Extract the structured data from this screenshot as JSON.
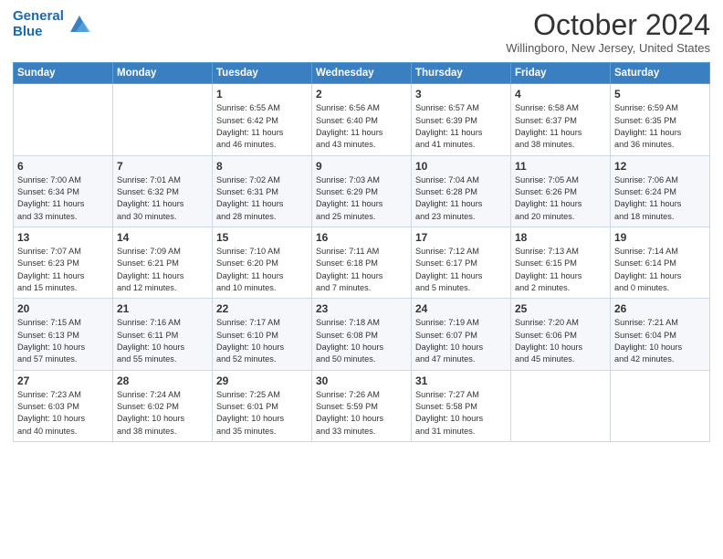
{
  "header": {
    "logo_line1": "General",
    "logo_line2": "Blue",
    "month": "October 2024",
    "location": "Willingboro, New Jersey, United States"
  },
  "columns": [
    "Sunday",
    "Monday",
    "Tuesday",
    "Wednesday",
    "Thursday",
    "Friday",
    "Saturday"
  ],
  "weeks": [
    [
      {
        "day": "",
        "info": ""
      },
      {
        "day": "",
        "info": ""
      },
      {
        "day": "1",
        "info": "Sunrise: 6:55 AM\nSunset: 6:42 PM\nDaylight: 11 hours\nand 46 minutes."
      },
      {
        "day": "2",
        "info": "Sunrise: 6:56 AM\nSunset: 6:40 PM\nDaylight: 11 hours\nand 43 minutes."
      },
      {
        "day": "3",
        "info": "Sunrise: 6:57 AM\nSunset: 6:39 PM\nDaylight: 11 hours\nand 41 minutes."
      },
      {
        "day": "4",
        "info": "Sunrise: 6:58 AM\nSunset: 6:37 PM\nDaylight: 11 hours\nand 38 minutes."
      },
      {
        "day": "5",
        "info": "Sunrise: 6:59 AM\nSunset: 6:35 PM\nDaylight: 11 hours\nand 36 minutes."
      }
    ],
    [
      {
        "day": "6",
        "info": "Sunrise: 7:00 AM\nSunset: 6:34 PM\nDaylight: 11 hours\nand 33 minutes."
      },
      {
        "day": "7",
        "info": "Sunrise: 7:01 AM\nSunset: 6:32 PM\nDaylight: 11 hours\nand 30 minutes."
      },
      {
        "day": "8",
        "info": "Sunrise: 7:02 AM\nSunset: 6:31 PM\nDaylight: 11 hours\nand 28 minutes."
      },
      {
        "day": "9",
        "info": "Sunrise: 7:03 AM\nSunset: 6:29 PM\nDaylight: 11 hours\nand 25 minutes."
      },
      {
        "day": "10",
        "info": "Sunrise: 7:04 AM\nSunset: 6:28 PM\nDaylight: 11 hours\nand 23 minutes."
      },
      {
        "day": "11",
        "info": "Sunrise: 7:05 AM\nSunset: 6:26 PM\nDaylight: 11 hours\nand 20 minutes."
      },
      {
        "day": "12",
        "info": "Sunrise: 7:06 AM\nSunset: 6:24 PM\nDaylight: 11 hours\nand 18 minutes."
      }
    ],
    [
      {
        "day": "13",
        "info": "Sunrise: 7:07 AM\nSunset: 6:23 PM\nDaylight: 11 hours\nand 15 minutes."
      },
      {
        "day": "14",
        "info": "Sunrise: 7:09 AM\nSunset: 6:21 PM\nDaylight: 11 hours\nand 12 minutes."
      },
      {
        "day": "15",
        "info": "Sunrise: 7:10 AM\nSunset: 6:20 PM\nDaylight: 11 hours\nand 10 minutes."
      },
      {
        "day": "16",
        "info": "Sunrise: 7:11 AM\nSunset: 6:18 PM\nDaylight: 11 hours\nand 7 minutes."
      },
      {
        "day": "17",
        "info": "Sunrise: 7:12 AM\nSunset: 6:17 PM\nDaylight: 11 hours\nand 5 minutes."
      },
      {
        "day": "18",
        "info": "Sunrise: 7:13 AM\nSunset: 6:15 PM\nDaylight: 11 hours\nand 2 minutes."
      },
      {
        "day": "19",
        "info": "Sunrise: 7:14 AM\nSunset: 6:14 PM\nDaylight: 11 hours\nand 0 minutes."
      }
    ],
    [
      {
        "day": "20",
        "info": "Sunrise: 7:15 AM\nSunset: 6:13 PM\nDaylight: 10 hours\nand 57 minutes."
      },
      {
        "day": "21",
        "info": "Sunrise: 7:16 AM\nSunset: 6:11 PM\nDaylight: 10 hours\nand 55 minutes."
      },
      {
        "day": "22",
        "info": "Sunrise: 7:17 AM\nSunset: 6:10 PM\nDaylight: 10 hours\nand 52 minutes."
      },
      {
        "day": "23",
        "info": "Sunrise: 7:18 AM\nSunset: 6:08 PM\nDaylight: 10 hours\nand 50 minutes."
      },
      {
        "day": "24",
        "info": "Sunrise: 7:19 AM\nSunset: 6:07 PM\nDaylight: 10 hours\nand 47 minutes."
      },
      {
        "day": "25",
        "info": "Sunrise: 7:20 AM\nSunset: 6:06 PM\nDaylight: 10 hours\nand 45 minutes."
      },
      {
        "day": "26",
        "info": "Sunrise: 7:21 AM\nSunset: 6:04 PM\nDaylight: 10 hours\nand 42 minutes."
      }
    ],
    [
      {
        "day": "27",
        "info": "Sunrise: 7:23 AM\nSunset: 6:03 PM\nDaylight: 10 hours\nand 40 minutes."
      },
      {
        "day": "28",
        "info": "Sunrise: 7:24 AM\nSunset: 6:02 PM\nDaylight: 10 hours\nand 38 minutes."
      },
      {
        "day": "29",
        "info": "Sunrise: 7:25 AM\nSunset: 6:01 PM\nDaylight: 10 hours\nand 35 minutes."
      },
      {
        "day": "30",
        "info": "Sunrise: 7:26 AM\nSunset: 5:59 PM\nDaylight: 10 hours\nand 33 minutes."
      },
      {
        "day": "31",
        "info": "Sunrise: 7:27 AM\nSunset: 5:58 PM\nDaylight: 10 hours\nand 31 minutes."
      },
      {
        "day": "",
        "info": ""
      },
      {
        "day": "",
        "info": ""
      }
    ]
  ]
}
